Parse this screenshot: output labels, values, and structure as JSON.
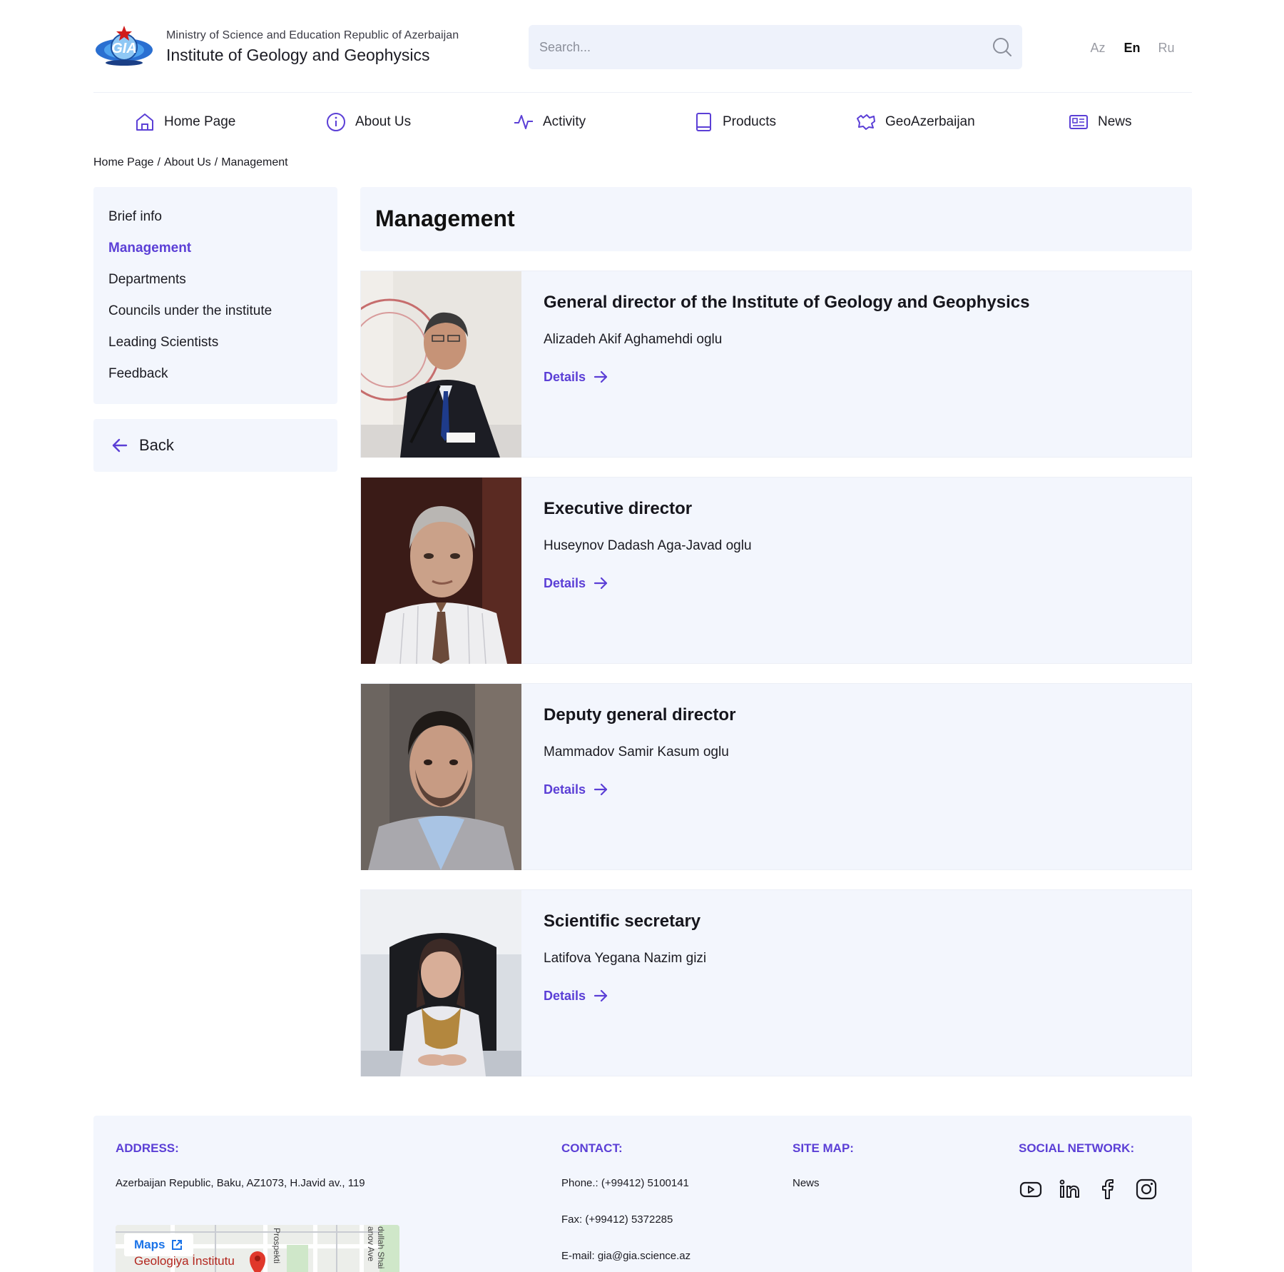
{
  "header": {
    "org_subtitle": "Ministry of Science and Education Republic of Azerbaijan",
    "org_title": "Institute of Geology and Geophysics",
    "logo_text": "GIA",
    "search_placeholder": "Search...",
    "languages": [
      "Az",
      "En",
      "Ru"
    ],
    "active_language": "En"
  },
  "nav": [
    {
      "label": "Home Page",
      "icon": "home-icon"
    },
    {
      "label": "About Us",
      "icon": "info-icon"
    },
    {
      "label": "Activity",
      "icon": "activity-icon"
    },
    {
      "label": "Products",
      "icon": "book-icon"
    },
    {
      "label": "GeoAzerbaijan",
      "icon": "map-outline-icon"
    },
    {
      "label": "News",
      "icon": "newspaper-icon"
    }
  ],
  "breadcrumb": [
    "Home Page",
    "About Us",
    "Management"
  ],
  "sidebar": {
    "items": [
      "Brief info",
      "Management",
      "Departments",
      "Councils under the institute",
      "Leading Scientists",
      "Feedback"
    ],
    "active_index": 1,
    "back_label": "Back"
  },
  "page_title": "Management",
  "cards": [
    {
      "title": "General director of the Institute of Geology and Geophysics",
      "name": "Alizadeh Akif Aghamehdi oglu",
      "details_label": "Details"
    },
    {
      "title": "Executive director",
      "name": "Huseynov Dadash Aga-Javad oglu",
      "details_label": "Details"
    },
    {
      "title": "Deputy general director",
      "name": "Mammadov Samir Kasum oglu",
      "details_label": "Details"
    },
    {
      "title": "Scientific secretary",
      "name": "Latifova Yegana Nazim gizi",
      "details_label": "Details"
    }
  ],
  "footer": {
    "address_heading": "ADDRESS:",
    "address": "Azerbaijan Republic, Baku, AZ1073, H.Javid av., 119",
    "contact_heading": "CONTACT:",
    "phone": "Phone.: (+99412) 5100141",
    "fax": "Fax: (+99412) 5372285",
    "email": "E-mail: gia@gia.science.az",
    "sitemap_heading": "SITE MAP:",
    "sitemap_items": [
      "News"
    ],
    "social_heading": "SOCIAL NETWORK:",
    "social_icons": [
      "youtube-icon",
      "linkedin-icon",
      "facebook-icon",
      "instagram-icon"
    ],
    "maps_label": "Maps",
    "map_label_geologiya": "Geologiya İnstitutu",
    "map_label_prospekti": "Prospekti",
    "map_label_avenue": "anov Ave",
    "map_label_shaig": "dullah Shai"
  },
  "colors": {
    "accent": "#5b3fd6",
    "panel": "#f3f6fd"
  }
}
